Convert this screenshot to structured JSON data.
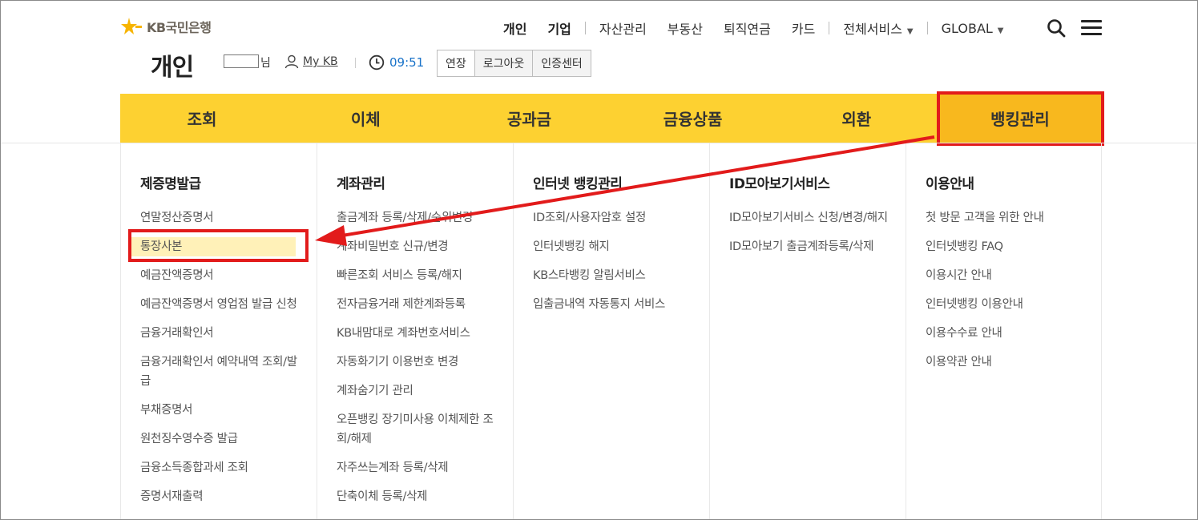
{
  "logo": {
    "brand": "KB국민은행"
  },
  "topnav": {
    "items": [
      "개인",
      "기업",
      "자산관리",
      "부동산",
      "퇴직연금",
      "카드",
      "전체서비스",
      "GLOBAL"
    ]
  },
  "section": {
    "title": "개인",
    "user_suffix": "님",
    "mykb": "My KB",
    "timer": "09:51",
    "buttons": [
      "연장",
      "로그아웃",
      "인증센터"
    ]
  },
  "mainnav": {
    "tabs": [
      "조회",
      "이체",
      "공과금",
      "금융상품",
      "외환",
      "뱅킹관리"
    ]
  },
  "mega": {
    "columns": [
      {
        "title": "제증명발급",
        "items": [
          "연말정산증명서",
          "통장사본",
          "예금잔액증명서",
          "예금잔액증명서 영업점 발급 신청",
          "금융거래확인서",
          "금융거래확인서 예약내역 조회/발급",
          "부채증명서",
          "원천징수영수증 발급",
          "금융소득종합과세 조회",
          "증명서재출력"
        ]
      },
      {
        "title": "계좌관리",
        "items": [
          "출금계좌 등록/삭제/순위변경",
          "계좌비밀번호 신규/변경",
          "빠른조회 서비스 등록/해지",
          "전자금융거래 제한계좌등록",
          "KB내맘대로 계좌번호서비스",
          "자동화기기 이용번호 변경",
          "계좌숨기기 관리",
          "오픈뱅킹 장기미사용 이체제한 조회/해제",
          "자주쓰는계좌 등록/삭제",
          "단축이체 등록/삭제"
        ]
      },
      {
        "title": "인터넷 뱅킹관리",
        "items": [
          "ID조회/사용자암호 설정",
          "인터넷뱅킹 해지",
          "KB스타뱅킹 알림서비스",
          "입출금내역 자동통지 서비스"
        ]
      },
      {
        "title": "ID모아보기서비스",
        "items": [
          "ID모아보기서비스 신청/변경/해지",
          "ID모아보기 출금계좌등록/삭제"
        ]
      },
      {
        "title": "이용안내",
        "items": [
          "첫 방문 고객을 위한 안내",
          "인터넷뱅킹 FAQ",
          "이용시간 안내",
          "인터넷뱅킹 이용안내",
          "이용수수료 안내",
          "이용약관 안내"
        ]
      }
    ]
  },
  "colors": {
    "nav_yellow": "#fdd131",
    "nav_active": "#f8b81e",
    "annotation_red": "#e21b1b",
    "highlight_bg": "#fff1b8",
    "timer_blue": "#1a73c9"
  }
}
